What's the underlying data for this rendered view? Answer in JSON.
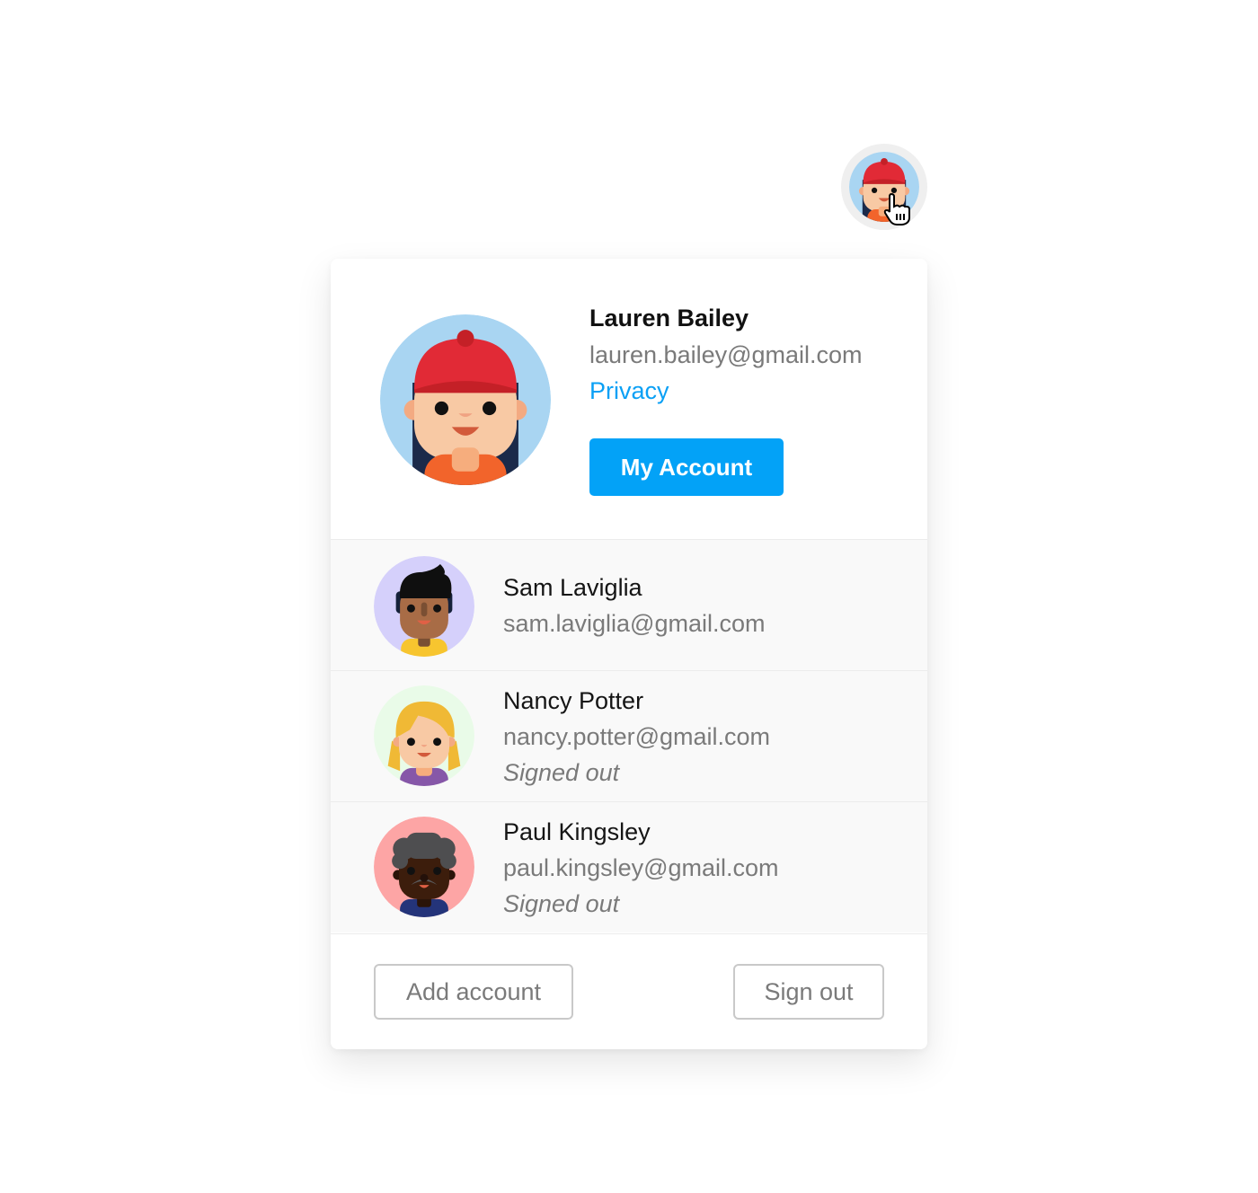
{
  "trigger": {
    "avatar_icon": "lauren-bailey-avatar",
    "cursor_icon": "hand-pointer-cursor"
  },
  "current_account": {
    "name": "Lauren Bailey",
    "email": "lauren.bailey@gmail.com",
    "privacy_link": "Privacy",
    "my_account_button": "My Account",
    "avatar_icon": "lauren-bailey-avatar"
  },
  "other_accounts": [
    {
      "name": "Sam Laviglia",
      "email": "sam.laviglia@gmail.com",
      "status": "",
      "avatar_icon": "sam-laviglia-avatar"
    },
    {
      "name": "Nancy Potter",
      "email": "nancy.potter@gmail.com",
      "status": "Signed out",
      "avatar_icon": "nancy-potter-avatar"
    },
    {
      "name": "Paul Kingsley",
      "email": "paul.kingsley@gmail.com",
      "status": "Signed out",
      "avatar_icon": "paul-kingsley-avatar"
    }
  ],
  "footer": {
    "add_account_button": "Add account",
    "sign_out_button": "Sign out"
  },
  "colors": {
    "accent": "#03a2f7",
    "link": "#0aa0f5",
    "secondary_text": "#7a7a7a",
    "list_background": "#f9f9f9"
  }
}
